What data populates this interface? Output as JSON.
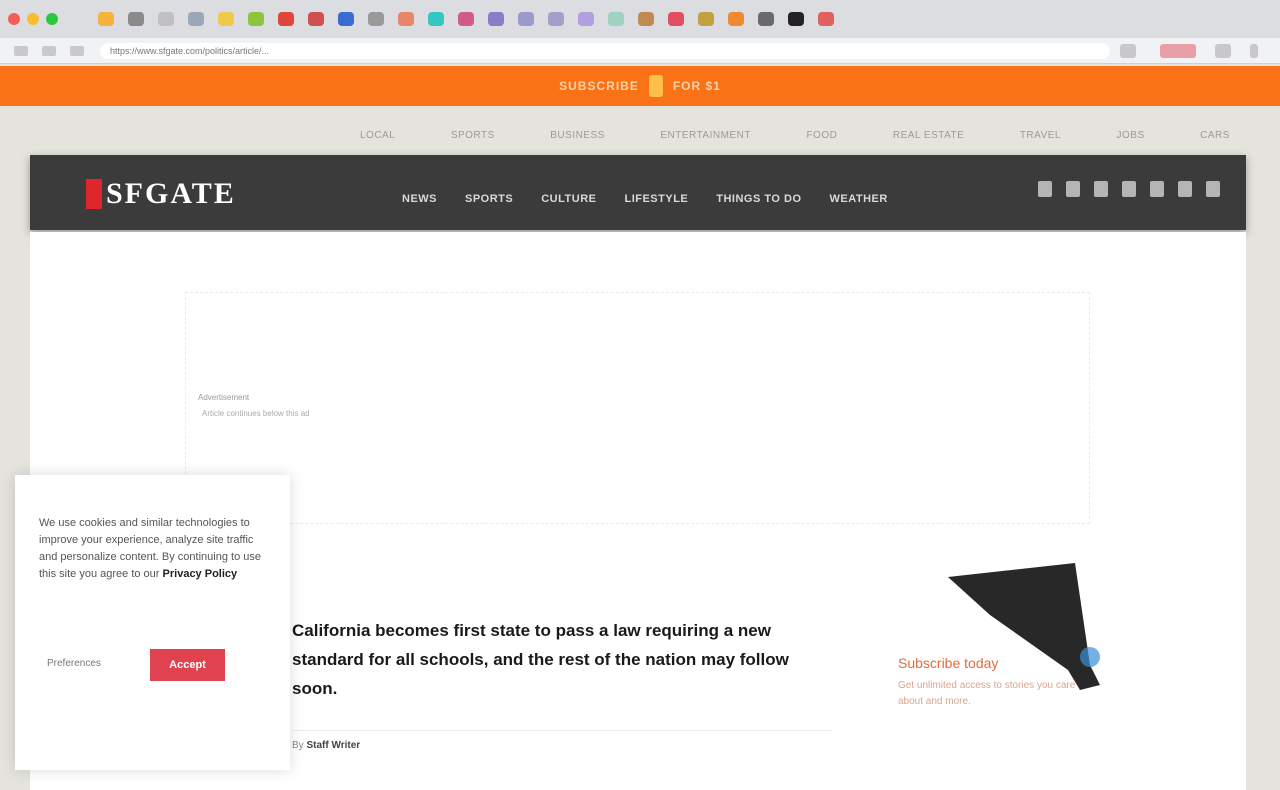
{
  "colors": {
    "promo_banner": "#f97316",
    "nav_bar": "#3b3b3b",
    "brand_red": "#e0262d",
    "accept_button": "#e0434f",
    "sidebar_promo_text": "#e36b3a"
  },
  "browser": {
    "tab_favicon_colors": [
      "#f3b33d",
      "#8a8a8a",
      "#c0c0c0",
      "#9aa7b8",
      "#f0c94a",
      "#8cc63f",
      "#e0453a",
      "#d05050",
      "#3a6bd1",
      "#9a9a9a",
      "#e8866a",
      "#34c6c0",
      "#d05a8a",
      "#8a7cc7",
      "#9a9acb",
      "#a0a0c8",
      "#b0a0e0",
      "#a0d0c0",
      "#c08a50",
      "#e05060",
      "#c0a040",
      "#f08a30",
      "#6a6a6a",
      "#222222",
      "#e06060"
    ],
    "url": "https://www.sfgate.com/politics/article/...",
    "extension_icons": [
      "star-icon",
      "extension-icon",
      "profile-icon",
      "menu-icon"
    ]
  },
  "promo": {
    "left_text": "SUBSCRIBE",
    "right_text": "FOR $1"
  },
  "top_links": [
    "Local",
    "Sports",
    "Business",
    "Entertainment",
    "Food",
    "Real Estate",
    "Travel",
    "Jobs",
    "Cars"
  ],
  "logo": {
    "text": "SFGATE"
  },
  "main_nav": [
    "News",
    "Sports",
    "Culture",
    "Lifestyle",
    "Things to Do",
    "Weather"
  ],
  "social_icons": [
    "facebook-icon",
    "twitter-icon",
    "instagram-icon",
    "email-icon",
    "search-icon",
    "menu-icon",
    "user-icon"
  ],
  "ad": {
    "label": "Advertisement",
    "sub": "Article continues below this ad"
  },
  "article": {
    "headline": "California becomes first state to pass a law requiring a new standard for all schools, and the rest of the nation may follow soon.",
    "byline_prefix": "By",
    "byline_author": "Staff Writer"
  },
  "sidebar_promo": {
    "title": "Subscribe today",
    "text": "Get unlimited access to stories you care about and more."
  },
  "cookie": {
    "text": "We use cookies and similar technologies to improve your experience, analyze site traffic and personalize content. By continuing to use this site you agree to our",
    "policy_link": "Privacy Policy",
    "preferences_label": "Preferences",
    "accept_label": "Accept"
  }
}
